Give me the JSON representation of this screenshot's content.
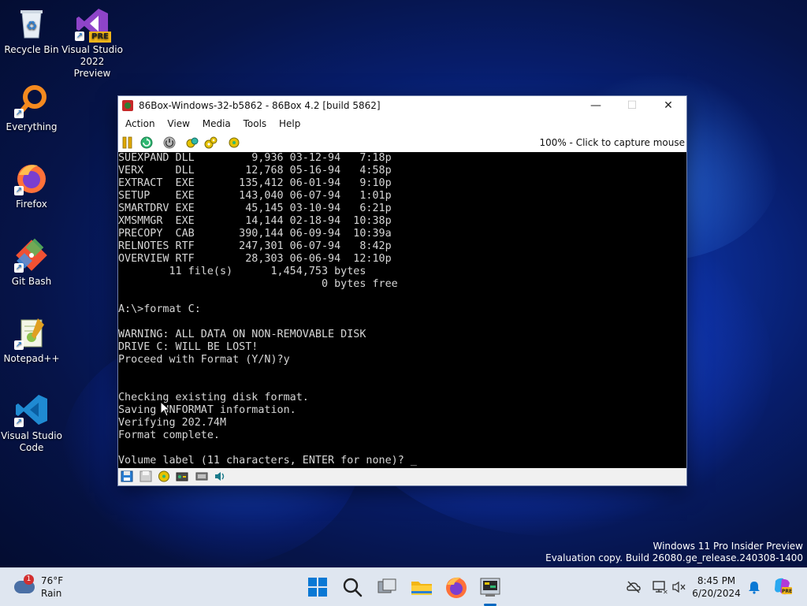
{
  "desktop": {
    "icons": [
      {
        "label": "Recycle Bin"
      },
      {
        "label": "Visual Studio 2022 Preview",
        "badge": "PRE"
      },
      {
        "label": "Everything"
      },
      {
        "label": "Firefox"
      },
      {
        "label": "Git Bash"
      },
      {
        "label": "Notepad++"
      },
      {
        "label": "Visual Studio Code"
      }
    ],
    "watermark": {
      "line1": "Windows 11 Pro Insider Preview",
      "line2": "Evaluation copy. Build 26080.ge_release.240308-1400"
    }
  },
  "window": {
    "title": "86Box-Windows-32-b5862 - 86Box 4.2 [build 5862]",
    "controls": {
      "minimize": "—",
      "maximize": "☐",
      "close": "✕"
    },
    "menu": [
      "Action",
      "View",
      "Media",
      "Tools",
      "Help"
    ],
    "capture_status": "100% - Click to capture mouse",
    "console_text": "SUEXPAND DLL         9,936 03-12-94   7:18p\nVERX     DLL        12,768 05-16-94   4:58p\nEXTRACT  EXE       135,412 06-01-94   9:10p\nSETUP    EXE       143,040 06-07-94   1:01p\nSMARTDRV EXE        45,145 03-10-94   6:21p\nXMSMMGR  EXE        14,144 02-18-94  10:38p\nPRECOPY  CAB       390,144 06-09-94  10:39a\nRELNOTES RTF       247,301 06-07-94   8:42p\nOVERVIEW RTF        28,303 06-06-94  12:10p\n        11 file(s)      1,454,753 bytes\n                                0 bytes free\n\nA:\\>format C:\n\nWARNING: ALL DATA ON NON-REMOVABLE DISK\nDRIVE C: WILL BE LOST!\nProceed with Format (Y/N)?y\n\n\nChecking existing disk format.\nSaving UNFORMAT information.\nVerifying 202.74M\nFormat complete.\n\nVolume label (11 characters, ENTER for none)? _"
  },
  "taskbar": {
    "weather": {
      "temp": "76°F",
      "condition": "Rain",
      "badge": "1"
    },
    "clock": {
      "time": "8:45 PM",
      "date": "6/20/2024"
    }
  },
  "colors": {
    "taskbar_bg": "#dfe6f0",
    "console_bg": "#000000",
    "console_fg": "#d6d6d6",
    "accent": "#0067c0"
  }
}
